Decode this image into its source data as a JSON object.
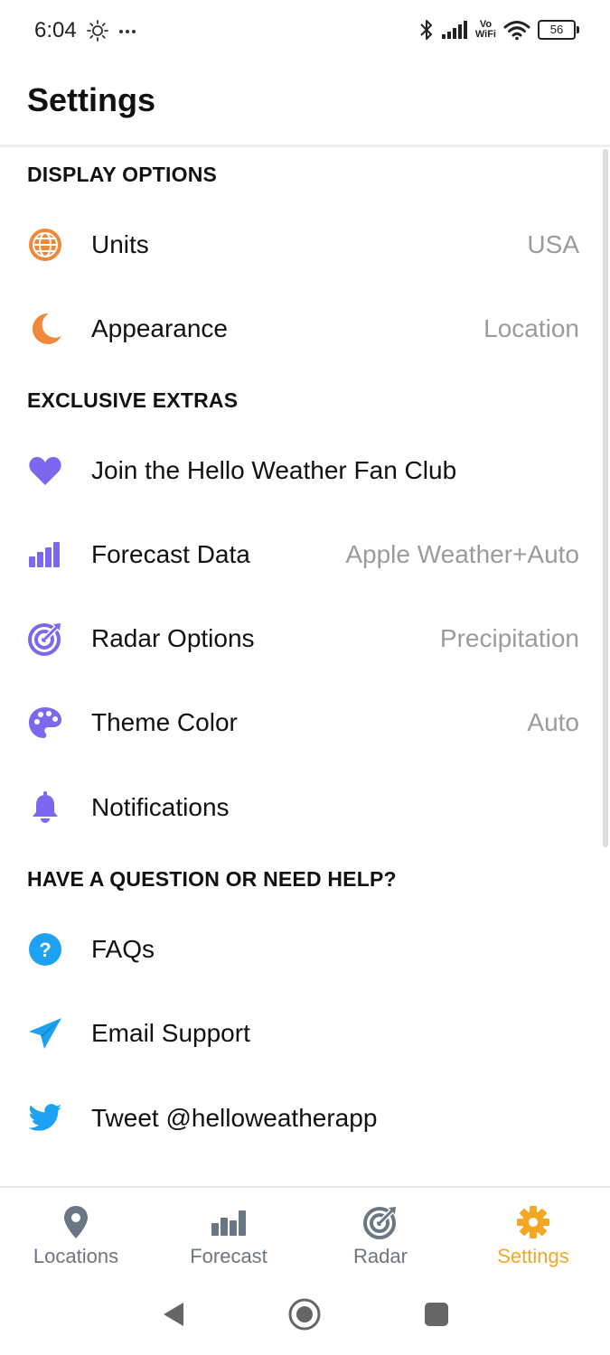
{
  "status_bar": {
    "time": "6:04",
    "left_icons": [
      "brightness-icon",
      "more-dots-icon"
    ],
    "vowifi_top": "Vo",
    "vowifi_bottom": "WiFi",
    "battery": "56"
  },
  "title": "Settings",
  "sections": {
    "display": {
      "header": "DISPLAY OPTIONS",
      "units": {
        "label": "Units",
        "value": "USA",
        "icon": "globe-icon",
        "color": "#f0883a"
      },
      "appearance": {
        "label": "Appearance",
        "value": "Location",
        "icon": "moon-icon",
        "color": "#f0883a"
      }
    },
    "extras": {
      "header": "EXCLUSIVE EXTRAS",
      "fan_club": {
        "label": "Join the Hello Weather Fan Club",
        "icon": "heart-icon",
        "color": "#7b68ee"
      },
      "forecast_data": {
        "label": "Forecast Data",
        "value": "Apple Weather+Auto",
        "icon": "bar-chart-icon",
        "color": "#7b68ee"
      },
      "radar_options": {
        "label": "Radar Options",
        "value": "Precipitation",
        "icon": "radar-icon",
        "color": "#7b68ee"
      },
      "theme_color": {
        "label": "Theme Color",
        "value": "Auto",
        "icon": "palette-icon",
        "color": "#7b68ee"
      },
      "notifications": {
        "label": "Notifications",
        "icon": "bell-icon",
        "color": "#7b68ee"
      }
    },
    "help": {
      "header": "HAVE A QUESTION OR NEED HELP?",
      "faqs": {
        "label": "FAQs",
        "icon": "question-icon",
        "color": "#1da1f2"
      },
      "email": {
        "label": "Email Support",
        "icon": "paper-plane-icon",
        "color": "#1da1f2"
      },
      "tweet": {
        "label": "Tweet @helloweatherapp",
        "icon": "twitter-icon",
        "color": "#1da1f2"
      }
    }
  },
  "tabs": {
    "locations": {
      "label": "Locations",
      "icon": "map-pin-icon"
    },
    "forecast": {
      "label": "Forecast",
      "icon": "bar-chart-icon"
    },
    "radar": {
      "label": "Radar",
      "icon": "radar-icon"
    },
    "settings": {
      "label": "Settings",
      "icon": "gear-icon",
      "active": true
    }
  },
  "colors": {
    "accent": "#f5a623",
    "tab_inactive": "#697684",
    "value_gray": "#9b9b9b",
    "orange": "#f0883a",
    "purple": "#7b68ee",
    "blue": "#1da1f2"
  }
}
